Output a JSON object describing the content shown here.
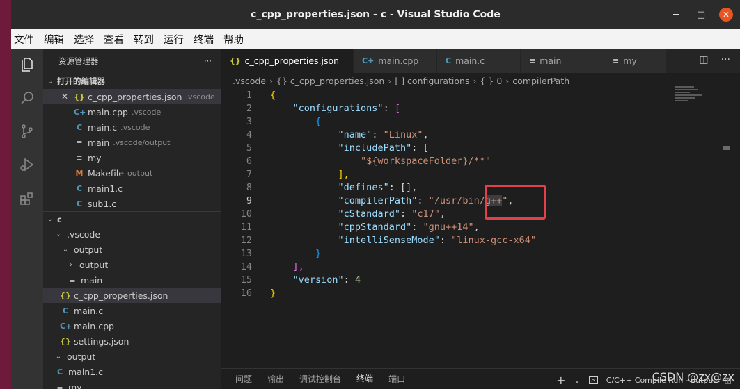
{
  "window": {
    "title": "c_cpp_properties.json - c - Visual Studio Code",
    "minimize": "─",
    "maximize": "□",
    "close": "✕"
  },
  "menu": [
    "文件",
    "编辑",
    "选择",
    "查看",
    "转到",
    "运行",
    "终端",
    "帮助"
  ],
  "activity_bar": [
    "explorer-icon",
    "search-icon",
    "source-control-icon",
    "run-debug-icon",
    "extensions-icon"
  ],
  "sidebar": {
    "title": "资源管理器",
    "more": "···",
    "open_editors_title": "打开的编辑器",
    "open_editors": [
      {
        "close": "✕",
        "icon": "{}",
        "icon_type": "json",
        "name": "c_cpp_properties.json",
        "desc": ".vscode"
      },
      {
        "icon": "C+",
        "icon_type": "cpp",
        "name": "main.cpp",
        "desc": ".vscode"
      },
      {
        "icon": "C",
        "icon_type": "c",
        "name": "main.c",
        "desc": ".vscode"
      },
      {
        "icon": "≡",
        "icon_type": "lines",
        "name": "main",
        "desc": ".vscode/output"
      },
      {
        "icon": "≡",
        "icon_type": "lines",
        "name": "my",
        "desc": ""
      },
      {
        "icon": "M",
        "icon_type": "m",
        "name": "Makefile",
        "desc": "output"
      },
      {
        "icon": "C",
        "icon_type": "c",
        "name": "main1.c",
        "desc": ""
      },
      {
        "icon": "C",
        "icon_type": "c",
        "name": "sub1.c",
        "desc": ""
      }
    ],
    "folder_title": "c",
    "tree": [
      {
        "chev": "⌄",
        "icon": "",
        "name": ".vscode"
      },
      {
        "chev": "⌄",
        "icon": "",
        "name": "output"
      },
      {
        "chev": "›",
        "icon": "",
        "name": "output"
      },
      {
        "chev": "",
        "icon": "≡",
        "name": "main"
      },
      {
        "chev": "",
        "icon": "{}",
        "name": "c_cpp_properties.json"
      },
      {
        "chev": "",
        "icon": "C",
        "name": "main.c"
      },
      {
        "chev": "",
        "icon": "C+",
        "name": "main.cpp"
      },
      {
        "chev": "",
        "icon": "{}",
        "name": "settings.json"
      },
      {
        "chev": "⌄",
        "icon": "",
        "name": "output"
      },
      {
        "chev": "",
        "icon": "C",
        "name": "main1.c"
      },
      {
        "chev": "",
        "icon": "≡",
        "name": "my"
      }
    ]
  },
  "tabs": [
    {
      "icon": "{}",
      "label": "c_cpp_properties.json"
    },
    {
      "icon": "C+",
      "label": "main.cpp"
    },
    {
      "icon": "C",
      "label": "main.c"
    },
    {
      "icon": "≡",
      "label": "main"
    },
    {
      "icon": "≡",
      "label": "my"
    }
  ],
  "tab_actions": {
    "split": "◫",
    "more": "···"
  },
  "breadcrumb": [
    ".vscode",
    "{} c_cpp_properties.json",
    "[ ] configurations",
    "{ } 0",
    "compilerPath"
  ],
  "code": {
    "line_numbers": [
      "1",
      "2",
      "3",
      "4",
      "5",
      "6",
      "7",
      "8",
      "9",
      "10",
      "11",
      "12",
      "13",
      "14",
      "15",
      "16"
    ],
    "current_line": "9",
    "lines": {
      "l1": "{",
      "l2_key": "\"configurations\"",
      "l2_rest": ": ",
      "l2_br": "[",
      "l3": "{",
      "l4_key": "\"name\"",
      "l4_val": "\"Linux\"",
      "l5_key": "\"includePath\"",
      "l5_br": "[",
      "l6_val": "\"${workspaceFolder}/**\"",
      "l7": "],",
      "l8_key": "\"defines\"",
      "l8_val": "[],",
      "l9_key": "\"compilerPath\"",
      "l9_val_a": "\"/usr/bin/",
      "l9_val_b": "g++",
      "l9_val_c": "\"",
      "l10_key": "\"cStandard\"",
      "l10_val": "\"c17\"",
      "l11_key": "\"cppStandard\"",
      "l11_val": "\"gnu++14\"",
      "l12_key": "\"intelliSenseMode\"",
      "l12_val": "\"linux-gcc-x64\"",
      "l13": "}",
      "l14": "],",
      "l15_key": "\"version\"",
      "l15_val": "4",
      "l16": "}"
    }
  },
  "panel": {
    "tabs": [
      "问题",
      "输出",
      "调试控制台",
      "终端",
      "端口"
    ],
    "active_tab": "终端",
    "add": "+",
    "chevron": "⌄",
    "terminal_name": "C/C++ Compile Run - output",
    "split": "◫"
  },
  "watermark": "CSDN @zx@zx",
  "colors": {
    "highlight_box": "#e2414a",
    "titlebar": "#2b2b2b",
    "close": "#e95420"
  }
}
